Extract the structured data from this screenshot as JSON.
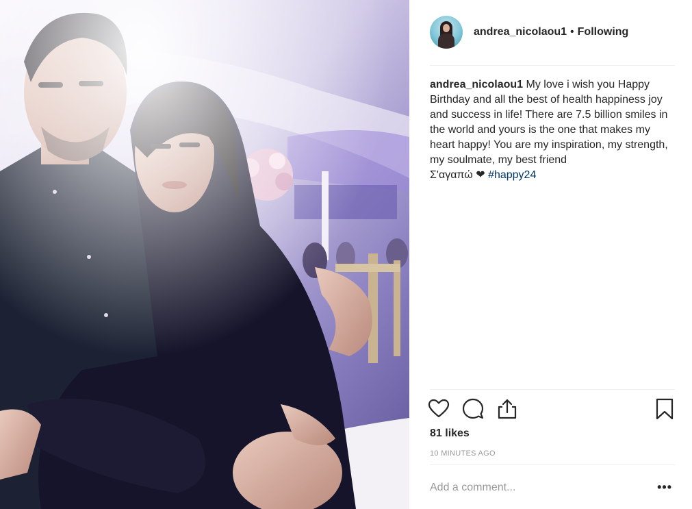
{
  "header": {
    "username": "andrea_nicolaou1",
    "separator": "•",
    "follow_status": "Following",
    "avatar_icon": "profile-avatar"
  },
  "caption": {
    "username": "andrea_nicolaou1",
    "text": "My love i wish you Happy Birthday and all the best of health happiness joy and success in life! There are 7.5 billion smiles in the world and yours is the one that makes my heart happy! You are my inspiration, my strength, my soulmate, my best friend",
    "second_line": "Σ'αγαπώ",
    "heart": "❤",
    "hashtag": "#happy24"
  },
  "actions": {
    "like_icon": "heart-outline-icon",
    "comment_icon": "comment-bubble-icon",
    "share_icon": "share-upload-icon",
    "save_icon": "bookmark-icon"
  },
  "likes": "81 likes",
  "timestamp": "10 MINUTES AGO",
  "comment": {
    "placeholder": "Add a comment...",
    "more_label": "•••"
  },
  "colors": {
    "text": "#262626",
    "muted": "#999999",
    "hashtag": "#003569",
    "divider": "#efefef"
  }
}
